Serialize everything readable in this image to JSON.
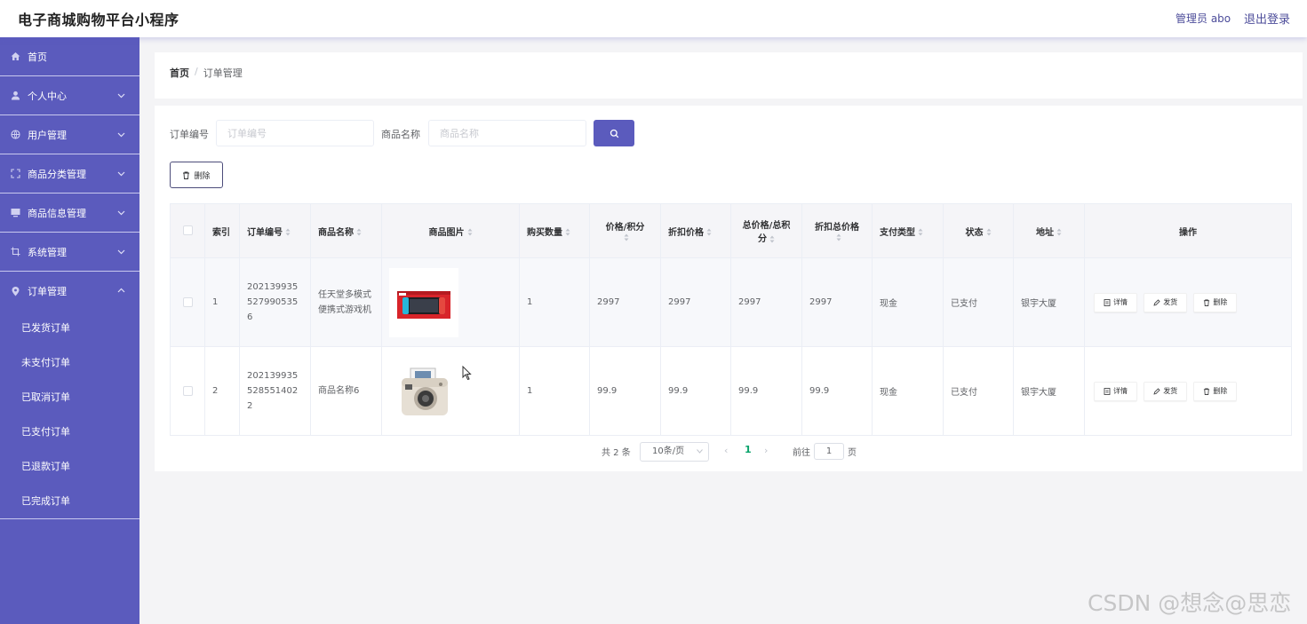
{
  "header": {
    "title": "电子商城购物平台小程序",
    "user": "管理员 abo",
    "logout": "退出登录"
  },
  "sidebar": {
    "items": [
      {
        "label": "首页",
        "icon": "home-icon"
      },
      {
        "label": "个人中心",
        "icon": "user-icon"
      },
      {
        "label": "用户管理",
        "icon": "globe-icon"
      },
      {
        "label": "商品分类管理",
        "icon": "fullscreen-icon"
      },
      {
        "label": "商品信息管理",
        "icon": "monitor-icon"
      },
      {
        "label": "系统管理",
        "icon": "crop-icon"
      },
      {
        "label": "订单管理",
        "icon": "location-icon"
      }
    ],
    "order_sub": [
      "已发货订单",
      "未支付订单",
      "已取消订单",
      "已支付订单",
      "已退款订单",
      "已完成订单"
    ]
  },
  "breadcrumb": {
    "home": "首页",
    "sep": "/",
    "current": "订单管理"
  },
  "search": {
    "order_label": "订单编号",
    "order_placeholder": "订单编号",
    "product_label": "商品名称",
    "product_placeholder": "商品名称"
  },
  "toolbar": {
    "delete_label": "删除"
  },
  "table": {
    "headers": [
      "索引",
      "订单编号",
      "商品名称",
      "商品图片",
      "购买数量",
      "价格/积分",
      "折扣价格",
      "总价格/总积分",
      "折扣总价格",
      "支付类型",
      "状态",
      "地址",
      "操作"
    ],
    "rows": [
      {
        "index": "1",
        "order_no": "2021399355279905356",
        "name": "任天堂多模式便携式游戏机",
        "image": "game-console",
        "qty": "1",
        "price": "2997",
        "discount": "2997",
        "total": "2997",
        "discount_total": "2997",
        "pay_type": "现金",
        "status": "已支付",
        "address": "银宇大厦"
      },
      {
        "index": "2",
        "order_no": "2021399355285514022",
        "name": "商品名称6",
        "image": "instant-camera",
        "qty": "1",
        "price": "99.9",
        "discount": "99.9",
        "total": "99.9",
        "discount_total": "99.9",
        "pay_type": "现金",
        "status": "已支付",
        "address": "银宇大厦"
      }
    ],
    "actions": {
      "detail": "详情",
      "ship": "发货",
      "delete": "删除"
    }
  },
  "pagination": {
    "total": "共 2 条",
    "page_size": "10条/页",
    "current": "1",
    "goto_prefix": "前往",
    "goto_value": "1",
    "goto_suffix": "页"
  },
  "watermark": "CSDN @想念@思恋",
  "colors": {
    "accent": "#5b5bbd",
    "active_page": "#0aa36b",
    "header_text": "#4c4c9a"
  }
}
